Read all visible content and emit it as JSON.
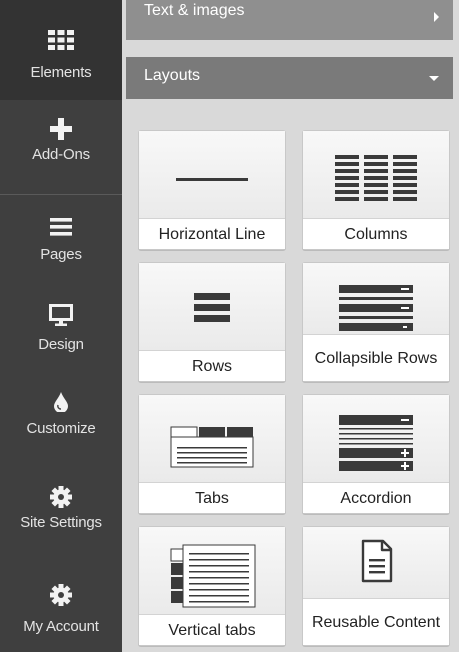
{
  "sidebar": {
    "items": [
      {
        "label": "Elements",
        "icon": "grid-icon"
      },
      {
        "label": "Add-Ons",
        "icon": "plus-icon"
      },
      {
        "label": "Pages",
        "icon": "menu-lines-icon"
      },
      {
        "label": "Design",
        "icon": "monitor-icon"
      },
      {
        "label": "Customize",
        "icon": "droplet-icon"
      },
      {
        "label": "Site Settings",
        "icon": "gear-icon"
      },
      {
        "label": "My Account",
        "icon": "gear-icon"
      }
    ]
  },
  "panel": {
    "sections": [
      {
        "title": "Text & images",
        "state": "collapsed"
      },
      {
        "title": "Layouts",
        "state": "expanded"
      }
    ],
    "tiles": [
      {
        "label": "Horizontal Line",
        "icon": "horizontal-line-icon"
      },
      {
        "label": "Columns",
        "icon": "columns-icon"
      },
      {
        "label": "Rows",
        "icon": "rows-icon"
      },
      {
        "label": "Collapsible Rows",
        "icon": "collapsible-rows-icon"
      },
      {
        "label": "Tabs",
        "icon": "tabs-icon"
      },
      {
        "label": "Accordion",
        "icon": "accordion-icon"
      },
      {
        "label": "Vertical tabs",
        "icon": "vertical-tabs-icon"
      },
      {
        "label": "Reusable Content",
        "icon": "document-icon"
      }
    ]
  },
  "colors": {
    "rail": "#3f3f3f",
    "rail_active": "#333333",
    "section_collapsed": "#8f8f8f",
    "section_expanded": "#7a7a7a",
    "panel_bg": "#d9d9d9",
    "icon_dark": "#3a3a3a"
  }
}
